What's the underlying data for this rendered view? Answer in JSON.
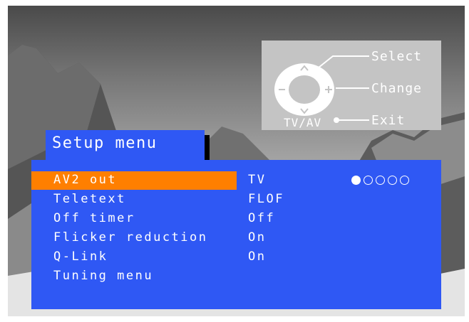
{
  "help": {
    "select_label": "Select",
    "change_label": "Change",
    "exit_label": "Exit",
    "tvav_label": "TV/AV",
    "icons": [
      "remote-dpad-icon",
      "arrow-up-icon",
      "arrow-down-icon",
      "minus-icon",
      "plus-icon",
      "exit-dot-icon"
    ]
  },
  "menu": {
    "title": "Setup menu",
    "items": [
      {
        "label": "AV2 out",
        "value": "TV",
        "selected": true
      },
      {
        "label": "Teletext",
        "value": "FLOF"
      },
      {
        "label": "Off timer",
        "value": "Off"
      },
      {
        "label": "Flicker reduction",
        "value": "On"
      },
      {
        "label": "Q-Link",
        "value": "On"
      },
      {
        "label": "Tuning menu",
        "value": ""
      }
    ],
    "page_indicator": {
      "total": 5,
      "current": 1
    }
  },
  "colors": {
    "menu_blue": "#2f58f4",
    "highlight_orange": "#ff7f00",
    "help_gray": "#c4c4c4",
    "text": "#ffffff"
  }
}
